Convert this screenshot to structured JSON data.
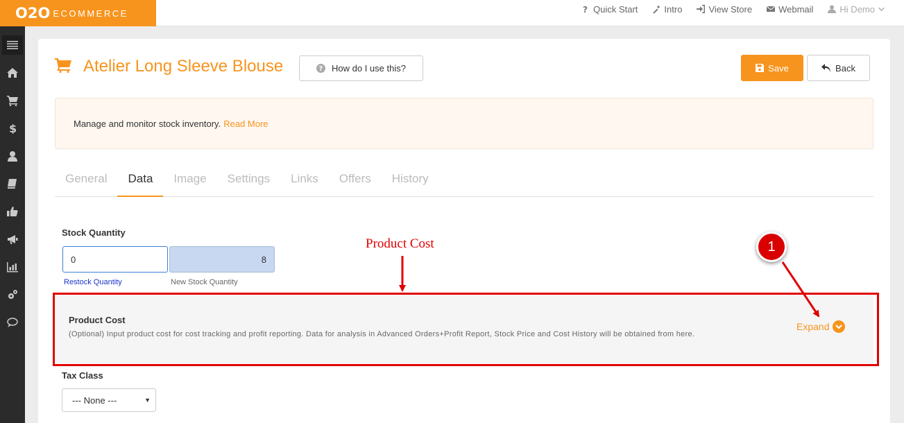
{
  "brand": {
    "mark": "O2O",
    "name": "ECOMMERCE"
  },
  "topnav": [
    {
      "label": "Quick Start",
      "icon": "question-icon"
    },
    {
      "label": "Intro",
      "icon": "magic-wand-icon"
    },
    {
      "label": "View Store",
      "icon": "sign-in-icon"
    },
    {
      "label": "Webmail",
      "icon": "envelope-icon"
    },
    {
      "label": "Hi Demo",
      "icon": "user-icon"
    }
  ],
  "sidebar": [
    "menu-icon",
    "home-icon",
    "cart-icon",
    "dollar-icon",
    "user-icon",
    "book-icon",
    "thumbs-up-icon",
    "bullhorn-icon",
    "bar-chart-icon",
    "cogs-icon",
    "comment-icon"
  ],
  "page": {
    "title": "Atelier Long Sleeve Blouse",
    "help_button": "How do I use this?",
    "save_label": "Save",
    "back_label": "Back"
  },
  "info": {
    "text": "Manage and monitor stock inventory.",
    "link": "Read More"
  },
  "tabs": [
    {
      "label": "General",
      "active": false
    },
    {
      "label": "Data",
      "active": true
    },
    {
      "label": "Image",
      "active": false
    },
    {
      "label": "Settings",
      "active": false
    },
    {
      "label": "Links",
      "active": false
    },
    {
      "label": "Offers",
      "active": false
    },
    {
      "label": "History",
      "active": false
    }
  ],
  "stock": {
    "label": "Stock Quantity",
    "restock_value": "0",
    "new_value": "8",
    "restock_hint": "Restock Quantity",
    "new_hint": "New Stock Quantity"
  },
  "cost": {
    "title": "Product Cost",
    "description": "(Optional) Input product cost for cost tracking and profit reporting. Data for analysis in Advanced Orders+Profit Report, Stock Price and Cost History will be obtained from here.",
    "expand_label": "Expand"
  },
  "tax": {
    "label": "Tax Class",
    "selected": "--- None ---"
  },
  "annotation": {
    "label": "Product Cost",
    "badge": "1"
  },
  "colors": {
    "accent": "#f7941d",
    "annotation": "#e00000",
    "sidebar": "#2b2b2b"
  }
}
